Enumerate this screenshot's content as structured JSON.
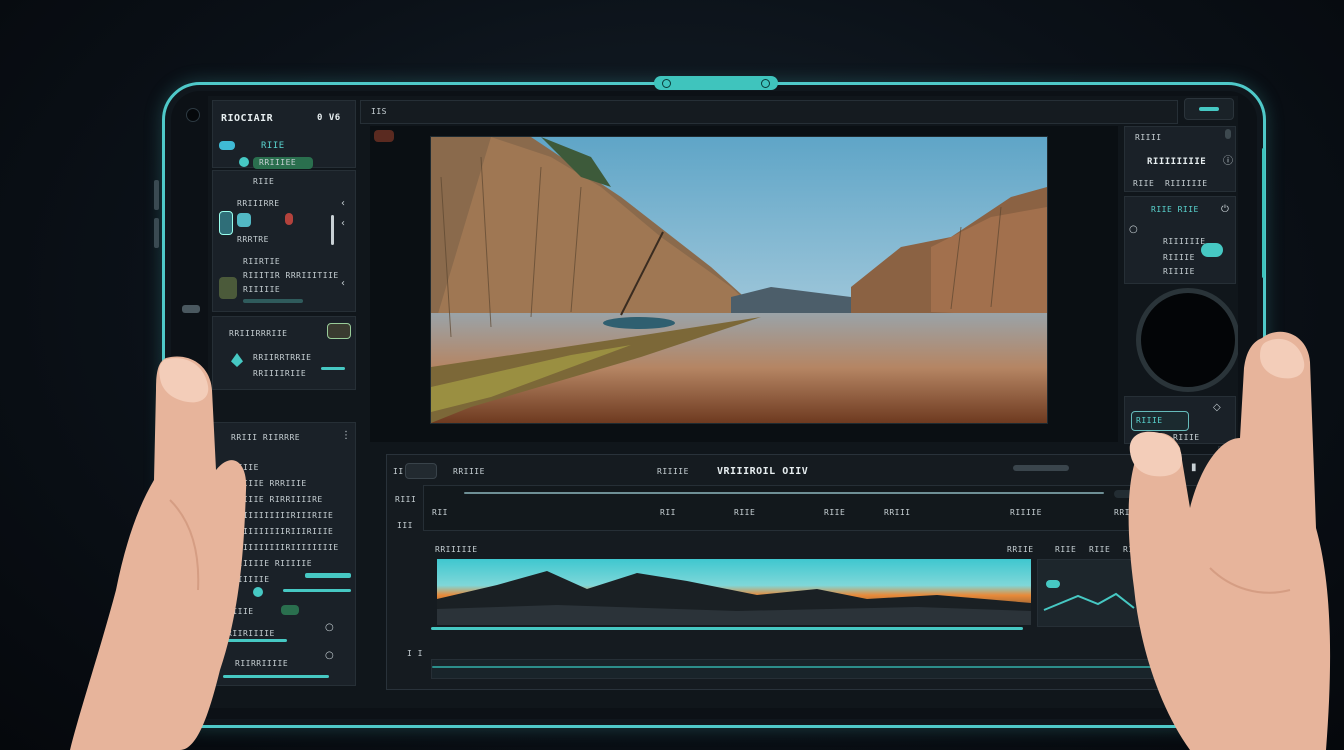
{
  "left_panel": {
    "title": "RIOCIAIR",
    "title_right": "0 V6",
    "tag_1": "RIIE",
    "tag_2": "RRIIIEE",
    "row_a": "RIIE",
    "row_b": "RRIIIRRE",
    "row_c": "RRRTRE",
    "row_d": "RIIRTIE",
    "row_e": "RRIIIEE",
    "list_1": "RIIITIR  RRRIIITIIE",
    "list_2": "RIIIIIE",
    "list_3": "RIIII",
    "section_1": "RRIIIRRRIIE",
    "item_1": "RRIIRRTRRIE",
    "item_2": "RRIIIIRIIE",
    "section_2": "RRIII RIIRRRE",
    "rows": [
      "RRIIIE",
      "RIIIIIE  RRRIIIE",
      "RRIIIIE  RIRRIIIIRE",
      "RRRIIIIIIIIIRIIIRIIE",
      "RRRIIIIIIIIRIIIRIIIE",
      "RRIIIIIIIIIRIIIIIIIIE",
      "RIIIIIIE  RIIIIIE",
      "RRIIIIIE",
      "RIIIE",
      "RIIRIIIIE",
      "RIIRRIIIIE"
    ]
  },
  "viewer": {
    "title_left": "IIS"
  },
  "timeline": {
    "header_left": "II",
    "header_label_1": "RRIIIE",
    "header_label_2": "RIIIIE",
    "header_title": "VRIIIROIL OIIV",
    "ruler_marks": [
      "RII",
      "RII",
      "RIIE",
      "RIIE",
      "RRIII",
      "RIIIIE",
      "RRIIIIE"
    ],
    "track_label": "RRIIIIIE",
    "track_right": [
      "RRIIE",
      "RIIE",
      "RIIE",
      "RIIE"
    ],
    "left_labels": [
      "RIII",
      "III",
      "I I"
    ]
  },
  "right_panel": {
    "header_1": "RIIII",
    "header_2": "RIIIIIIIII",
    "title": "RIIIIIIIIE",
    "sub_1": "RIIE",
    "sub_2": "RIIIIIIE",
    "group_title": "RIIE  RIIE",
    "line_1": "RIIIIIIE",
    "line_2": "RIIIIE",
    "line_3": "RIIIIE",
    "toggle_label": "RIIIE",
    "toggle_value": "RIIIE"
  },
  "colors": {
    "accent": "#46c8c3",
    "bezel": "#4fc9c9",
    "background": "#0b1118"
  }
}
